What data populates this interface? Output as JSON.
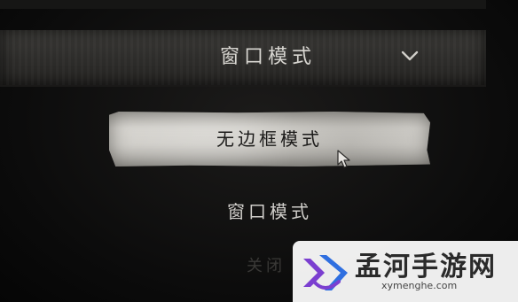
{
  "display_mode": {
    "selected_value": "窗口模式",
    "dropdown_options": [
      {
        "label": "无边框模式",
        "highlighted": true
      },
      {
        "label": "窗口模式",
        "highlighted": false
      }
    ]
  },
  "background_partial_label": "关闭",
  "watermark": {
    "name": "孟河手游网",
    "url": "xymenghe.com"
  },
  "icons": {
    "chevron": "chevron-down-icon",
    "cursor": "mouse-cursor-icon",
    "logo": "menghe-logo-icon"
  },
  "colors": {
    "bar": "#2f2e2c",
    "highlight": "#cfcdc8",
    "text_light": "#d8d6d1",
    "logo_purple": "#7b3fd0",
    "logo_blue": "#2f6fe0"
  }
}
